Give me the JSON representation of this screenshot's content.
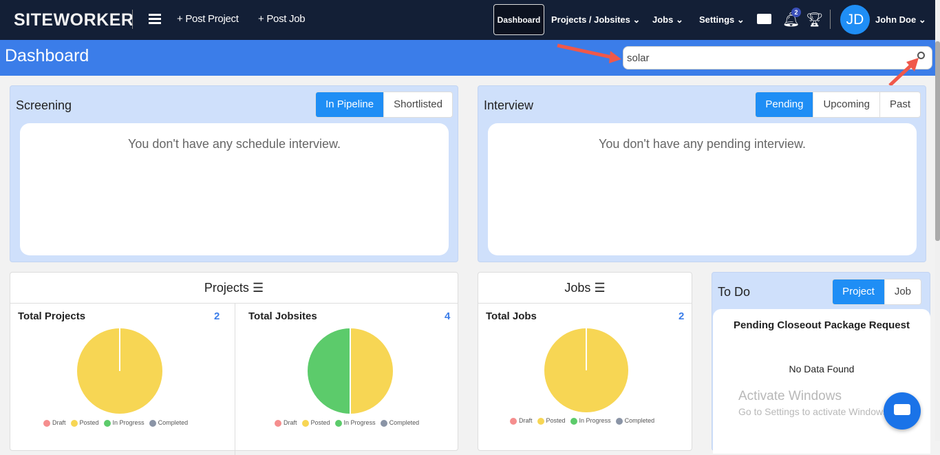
{
  "nav": {
    "logo": "SITEWORKER",
    "post_project": "+ Post Project",
    "post_job": "+ Post Job",
    "dashboard": "Dashboard",
    "projects": "Projects / Jobsites",
    "jobs": "Jobs",
    "settings": "Settings",
    "notif_count": "2",
    "avatar": "JD",
    "user": "John Doe"
  },
  "header": {
    "title": "Dashboard",
    "search_value": "solar"
  },
  "screening": {
    "title": "Screening",
    "tabs": [
      "In Pipeline",
      "Shortlisted"
    ],
    "empty": "You don't have any schedule interview."
  },
  "interview": {
    "title": "Interview",
    "tabs": [
      "Pending",
      "Upcoming",
      "Past"
    ],
    "empty": "You don't have any pending interview."
  },
  "projects": {
    "title": "Projects",
    "total_projects_label": "Total Projects",
    "total_projects": "2",
    "total_jobsites_label": "Total Jobsites",
    "total_jobsites": "4"
  },
  "jobs": {
    "title": "Jobs",
    "total_jobs_label": "Total Jobs",
    "total_jobs": "2"
  },
  "todo": {
    "title": "To Do",
    "tabs": [
      "Project",
      "Job"
    ],
    "subtitle": "Pending Closeout Package Request",
    "empty": "No Data Found"
  },
  "legend": [
    "Draft",
    "Posted",
    "In Progress",
    "Completed"
  ],
  "watermark": {
    "line1": "Activate Windows",
    "line2": "Go to Settings to activate Windows."
  },
  "chart_data": [
    {
      "type": "pie",
      "title": "Total Projects",
      "categories": [
        "Draft",
        "Posted",
        "In Progress",
        "Completed"
      ],
      "values": [
        0,
        2,
        0,
        0
      ]
    },
    {
      "type": "pie",
      "title": "Total Jobsites",
      "categories": [
        "Draft",
        "Posted",
        "In Progress",
        "Completed"
      ],
      "values": [
        0,
        2,
        2,
        0
      ]
    },
    {
      "type": "pie",
      "title": "Total Jobs",
      "categories": [
        "Draft",
        "Posted",
        "In Progress",
        "Completed"
      ],
      "values": [
        0,
        2,
        0,
        0
      ]
    }
  ],
  "colors": {
    "Draft": "#f58e8e",
    "Posted": "#f7d654",
    "In Progress": "#5ccb6b",
    "Completed": "#8a94a6",
    "accent": "#3b7de9",
    "nav": "#131f36"
  }
}
